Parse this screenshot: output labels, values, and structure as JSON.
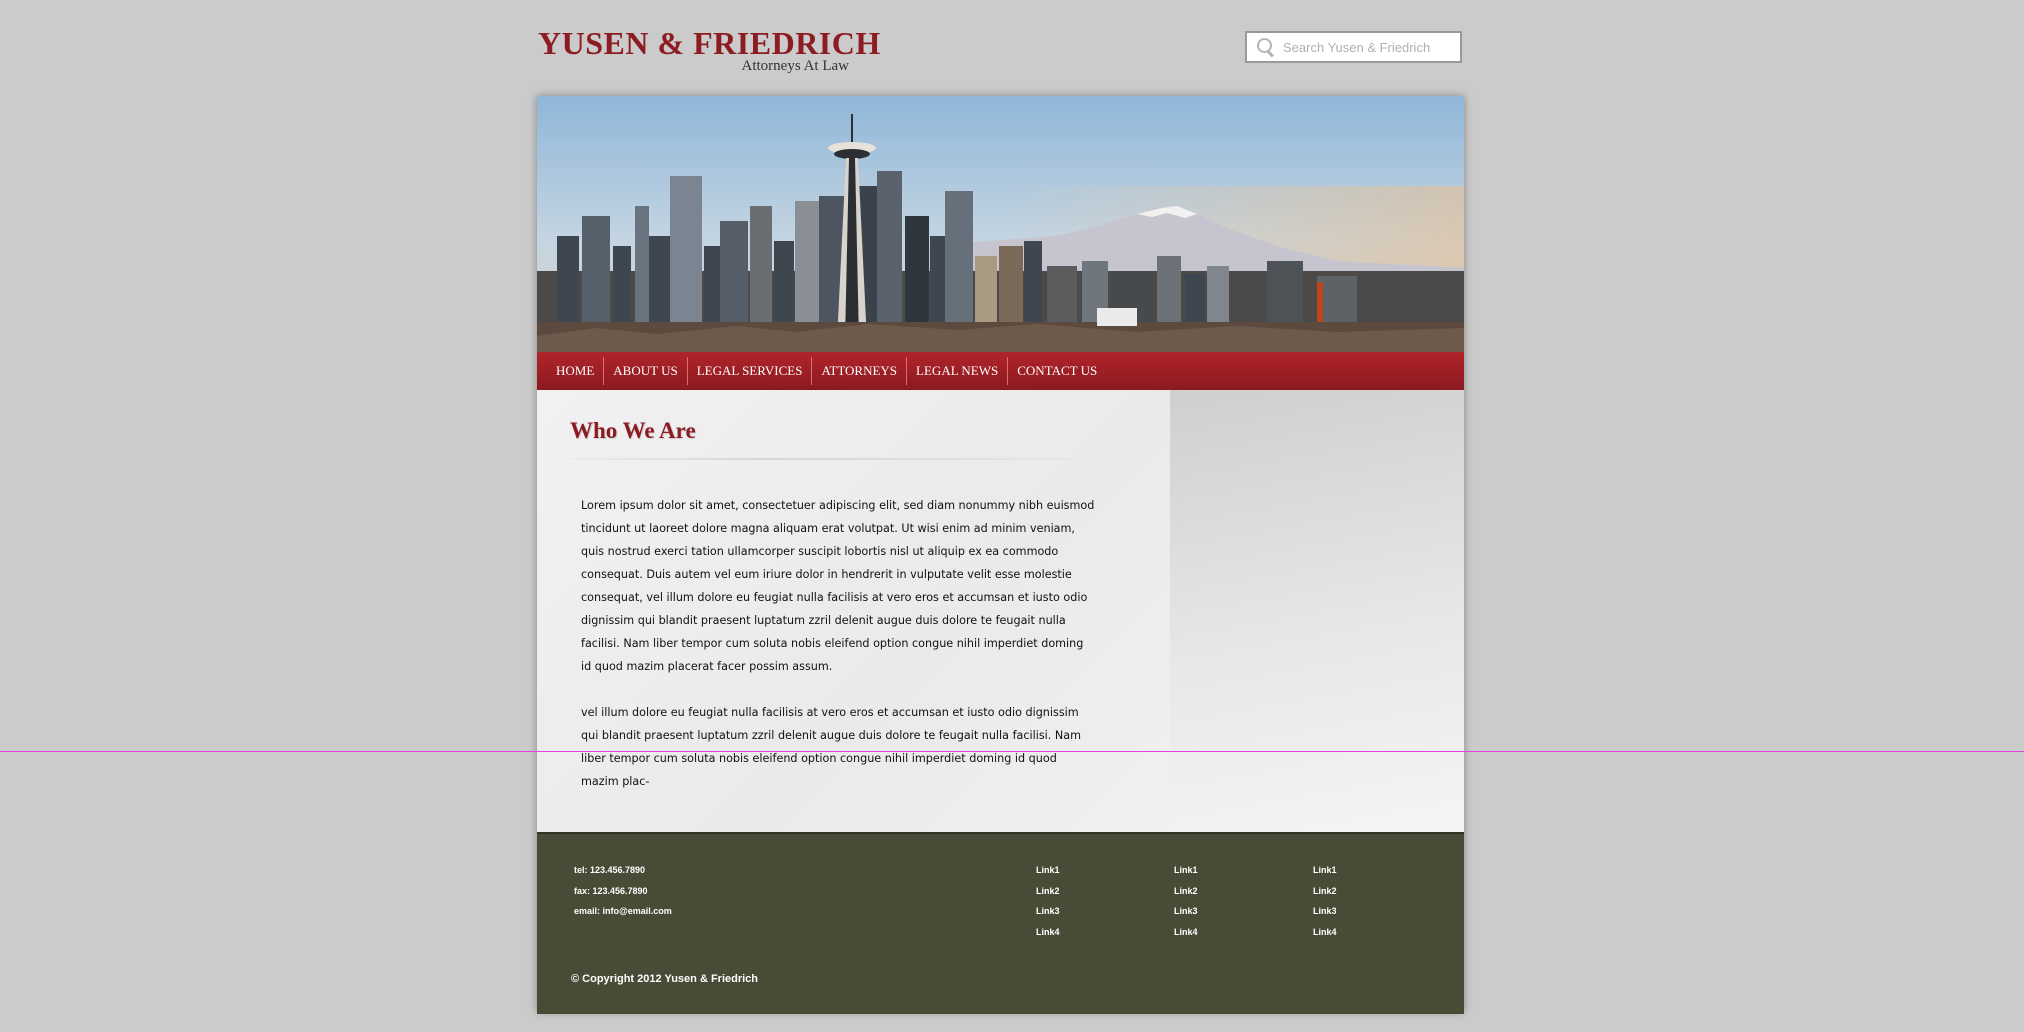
{
  "header": {
    "logo_title": "YUSEN & FRIEDRICH",
    "logo_subtitle": "Attorneys At Law",
    "search_placeholder": "Search Yusen & Friedrich",
    "search_icon": "search-icon"
  },
  "nav": {
    "items": [
      "HOME",
      "ABOUT US",
      "LEGAL SERVICES",
      "ATTORNEYS",
      "LEGAL NEWS",
      "CONTACT US"
    ]
  },
  "main": {
    "heading": "Who We Are",
    "paragraph1": "Lorem ipsum dolor sit amet, consectetuer adipiscing elit, sed diam nonummy nibh euismod tincidunt ut laoreet dolore magna aliquam erat volutpat. Ut wisi enim ad minim veniam, quis nostrud exerci tation ullamcorper suscipit lobortis nisl ut aliquip ex ea commodo consequat. Duis autem vel eum iriure dolor in hendrerit in vulputate velit esse molestie consequat, vel illum dolore eu feugiat nulla facilisis at vero eros et accumsan et iusto odio dignissim qui blandit praesent luptatum zzril delenit augue duis dolore te feugait nulla facilisi. Nam liber tempor cum soluta nobis eleifend option congue nihil imperdiet doming id quod mazim placerat facer possim assum.",
    "paragraph2": "vel illum dolore eu feugiat nulla facilisis at vero eros et accumsan et iusto odio dignissim qui blandit praesent luptatum zzril delenit augue duis dolore te feugait nulla facilisi. Nam liber tempor cum soluta nobis eleifend option congue nihil imperdiet doming id quod mazim plac-"
  },
  "footer": {
    "tel": "tel: 123.456.7890",
    "fax": "fax: 123.456.7890",
    "email": "email: info@email.com",
    "link_columns": [
      [
        "Link1",
        "Link2",
        "Link3",
        "Link4"
      ],
      [
        "Link1",
        "Link2",
        "Link3",
        "Link4"
      ],
      [
        "Link1",
        "Link2",
        "Link3",
        "Link4"
      ]
    ],
    "copyright": "© Copyright 2012 Yusen & Friedrich"
  },
  "colors": {
    "brand_red": "#8d1c22",
    "nav_red": "#a3222a",
    "footer_green": "#464c36",
    "page_bg": "#cbcbcb"
  }
}
